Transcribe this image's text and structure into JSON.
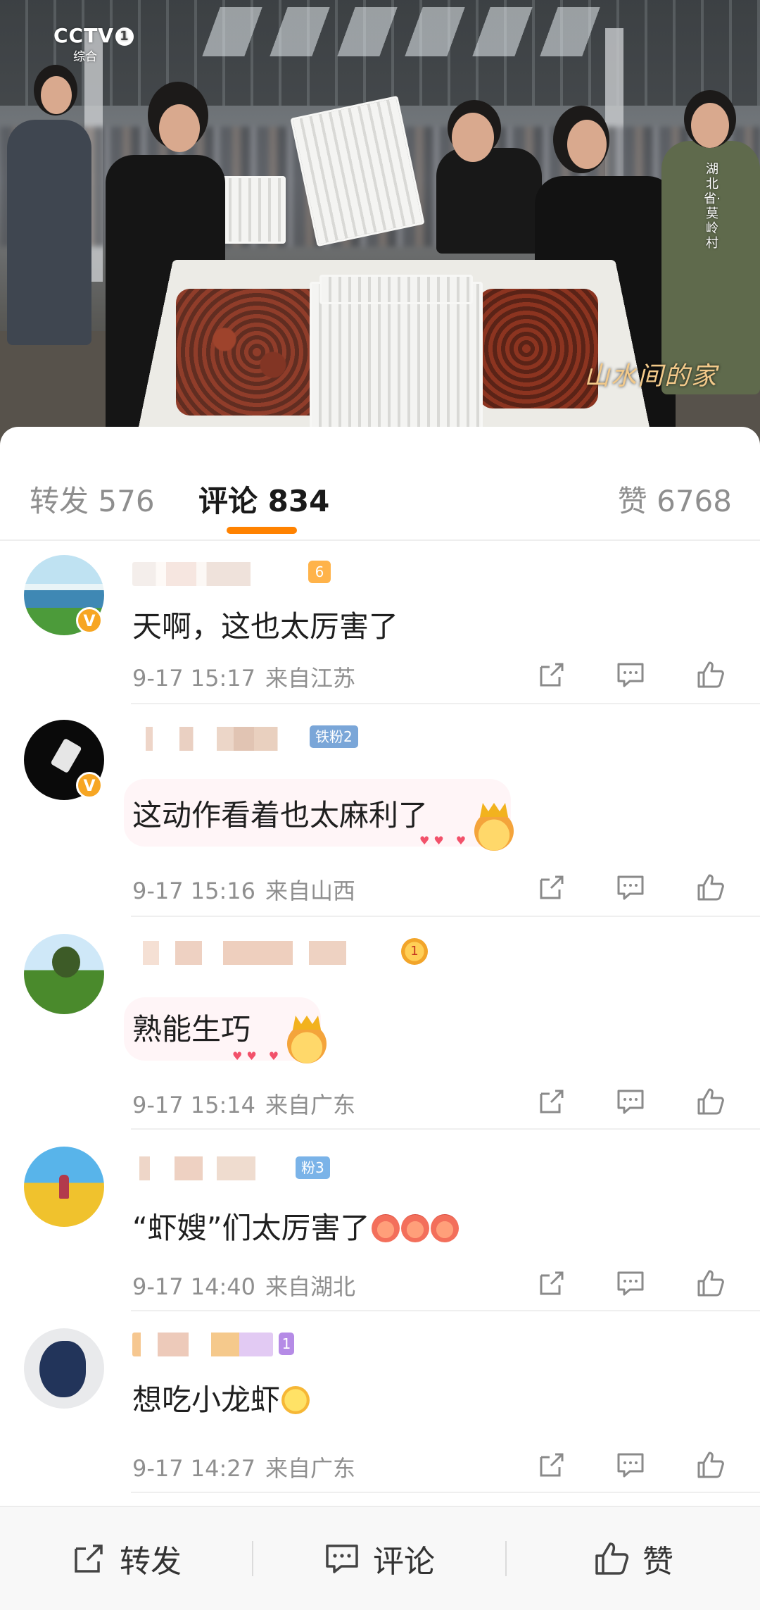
{
  "video": {
    "channel_logo": "CCTV",
    "channel_number": "1",
    "channel_sub": "综合",
    "location_caption": "湖北省·莫岭村",
    "program_title": "山水间的家"
  },
  "tabs": {
    "repost": {
      "label": "转发",
      "count": "576"
    },
    "comment": {
      "label": "评论",
      "count": "834"
    },
    "like": {
      "label": "赞",
      "count": "6768"
    },
    "active": "comment",
    "accent_color": "#ff8200"
  },
  "comments": [
    {
      "text": "天啊，这也太厉害了",
      "time": "9-17 15:17",
      "location": "来自江苏",
      "verified": true,
      "badge": "6"
    },
    {
      "text": "这动作看着也太麻利了",
      "time": "9-17 15:16",
      "location": "来自山西",
      "verified": true,
      "badge": "铁粉2"
    },
    {
      "text": "熟能生巧",
      "time": "9-17 15:14",
      "location": "来自广东",
      "verified": false,
      "badge": "1"
    },
    {
      "text": "“虾嫂”们太厉害了",
      "time": "9-17 14:40",
      "location": "来自湖北",
      "verified": false,
      "badge": "粉3"
    },
    {
      "text": "想吃小龙虾",
      "time": "9-17 14:27",
      "location": "来自广东",
      "verified": false,
      "badge": "1"
    }
  ],
  "comment_actions": {
    "share_icon": "share-icon",
    "reply_icon": "comment-icon",
    "like_icon": "thumbs-up-icon"
  },
  "bottom_bar": {
    "repost": "转发",
    "comment": "评论",
    "like": "赞"
  },
  "colors": {
    "verified_badge": "#f7a623",
    "text_primary": "#1f1f1f",
    "text_secondary": "#8f8f8f"
  }
}
